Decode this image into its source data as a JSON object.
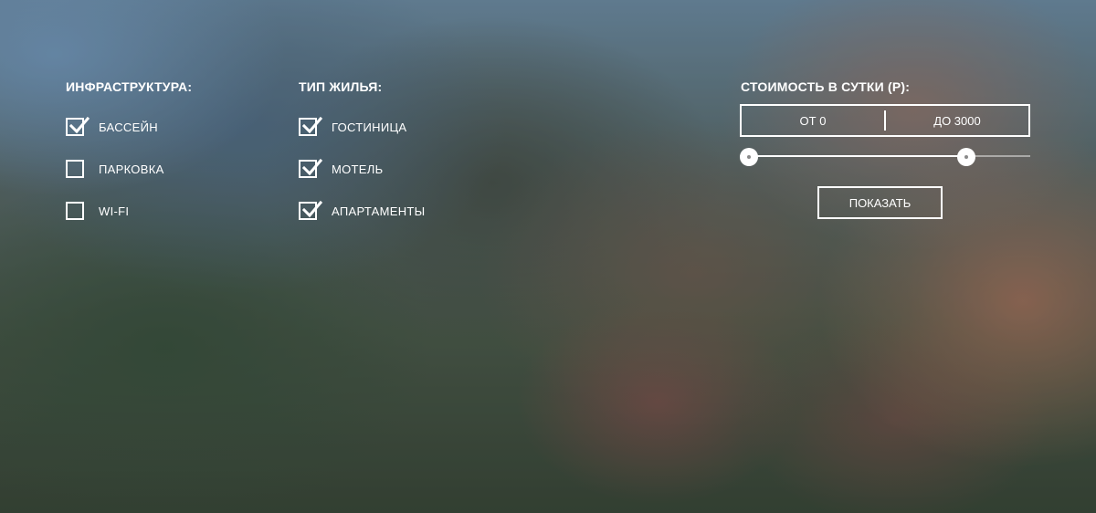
{
  "infrastructure": {
    "title": "ИНФРАСТРУКТУРА:",
    "options": [
      {
        "label": "БАССЕЙН",
        "checked": true
      },
      {
        "label": "ПАРКОВКА",
        "checked": false
      },
      {
        "label": "WI-FI",
        "checked": false
      }
    ]
  },
  "housing": {
    "title": "ТИП ЖИЛЬЯ:",
    "options": [
      {
        "label": "ГОСТИНИЦА",
        "checked": true
      },
      {
        "label": "МОТЕЛЬ",
        "checked": true
      },
      {
        "label": "АПАРТАМЕНТЫ",
        "checked": true
      }
    ]
  },
  "price": {
    "title": "СТОИМОСТЬ В СУТКИ (Р):",
    "from_label": "ОТ 0",
    "to_label": "ДО 3000",
    "slider_min_fraction": 0.0,
    "slider_max_fraction": 0.8
  },
  "show_button": {
    "label": "ПОКАЗАТЬ"
  },
  "icons": {
    "check": "checkmark-icon"
  },
  "colors": {
    "foreground": "#ffffff"
  }
}
